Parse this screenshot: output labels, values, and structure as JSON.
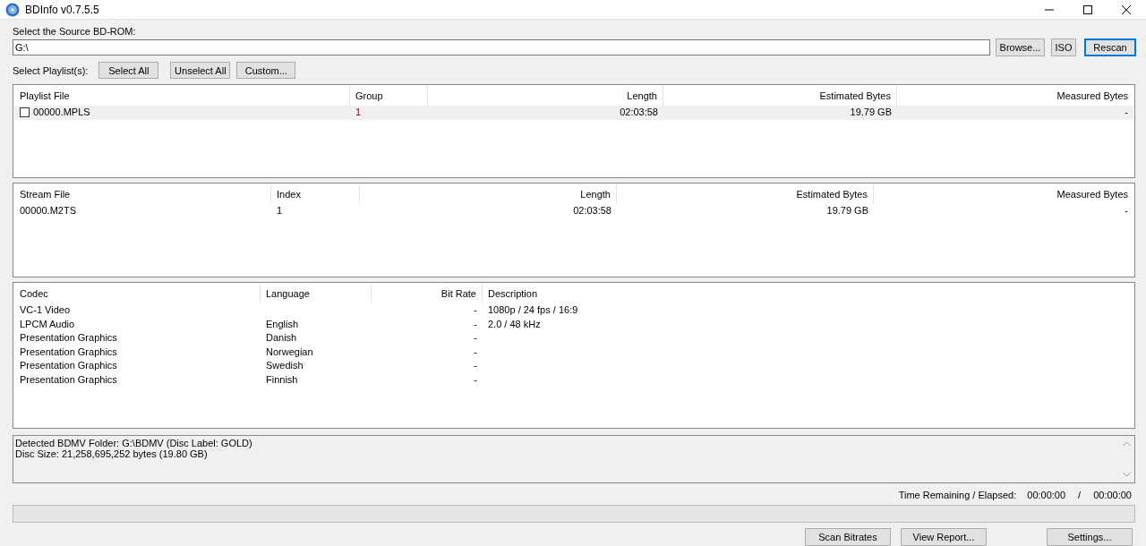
{
  "window": {
    "title": "BDInfo v0.7.5.5"
  },
  "source": {
    "label": "Select the Source BD-ROM:",
    "value": "G:\\",
    "buttons": [
      {
        "label": "Browse...",
        "default": false
      },
      {
        "label": "ISO",
        "default": false
      },
      {
        "label": "Rescan",
        "default": true
      }
    ]
  },
  "playlist_select": {
    "label": "Select Playlist(s):",
    "buttons": [
      "Select All",
      "Unselect All",
      "Custom..."
    ]
  },
  "playlist_table": {
    "columns": [
      {
        "label": "Playlist File",
        "kind": "text"
      },
      {
        "label": "Group",
        "kind": "text"
      },
      {
        "label": "Length",
        "kind": "number"
      },
      {
        "label": "Estimated Bytes",
        "kind": "number"
      },
      {
        "label": "Measured Bytes",
        "kind": "number"
      }
    ],
    "rows": [
      {
        "selected": true,
        "checked": false,
        "cells": [
          "00000.MPLS",
          "1",
          "02:03:58",
          "19.79 GB",
          "-"
        ]
      }
    ]
  },
  "stream_table": {
    "columns": [
      {
        "label": "Stream File",
        "kind": "text"
      },
      {
        "label": "Index",
        "kind": "text"
      },
      {
        "label": "Length",
        "kind": "number"
      },
      {
        "label": "Estimated Bytes",
        "kind": "number"
      },
      {
        "label": "Measured Bytes",
        "kind": "number"
      }
    ],
    "rows": [
      {
        "cells": [
          "00000.M2TS",
          "1",
          "02:03:58",
          "19.79 GB",
          "-"
        ]
      }
    ]
  },
  "codec_table": {
    "columns": [
      {
        "label": "Codec",
        "kind": "text"
      },
      {
        "label": "Language",
        "kind": "text"
      },
      {
        "label": "Bit Rate",
        "kind": "number"
      },
      {
        "label": "Description",
        "kind": "text"
      }
    ],
    "rows": [
      {
        "cells": [
          "VC-1 Video",
          "",
          "-",
          "1080p / 24 fps / 16:9"
        ]
      },
      {
        "cells": [
          "LPCM Audio",
          "English",
          "-",
          "2.0 / 48 kHz"
        ]
      },
      {
        "cells": [
          "Presentation Graphics",
          "Danish",
          "-",
          ""
        ]
      },
      {
        "cells": [
          "Presentation Graphics",
          "Norwegian",
          "-",
          ""
        ]
      },
      {
        "cells": [
          "Presentation Graphics",
          "Swedish",
          "-",
          ""
        ]
      },
      {
        "cells": [
          "Presentation Graphics",
          "Finnish",
          "-",
          ""
        ]
      }
    ]
  },
  "info_text": [
    "Detected BDMV Folder: G:\\BDMV (Disc Label: GOLD)",
    "Disc Size: 21,258,695,252 bytes (19.80 GB)"
  ],
  "time": {
    "label": "Time Remaining / Elapsed:",
    "remaining": "00:00:00",
    "separator": "/",
    "elapsed": "00:00:00"
  },
  "progress": {
    "level": 0
  },
  "bottom_buttons": [
    "Scan Bitrates",
    "View Report...",
    "Settings..."
  ]
}
